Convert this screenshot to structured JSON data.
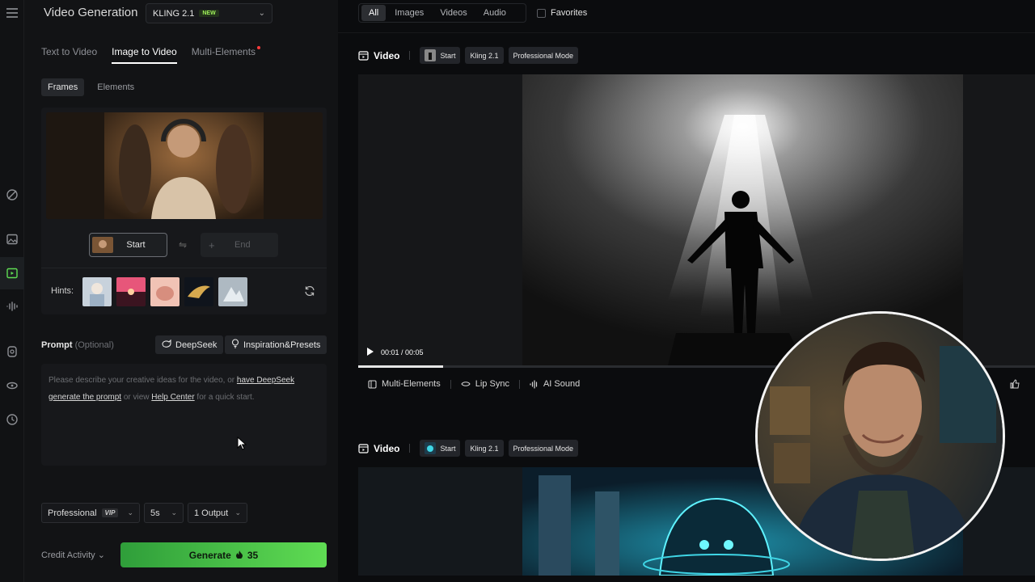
{
  "panel": {
    "title": "Video Generation",
    "model": {
      "name": "KLING 2.1",
      "badge": "NEW"
    },
    "tabs": [
      {
        "label": "Text to Video",
        "active": false
      },
      {
        "label": "Image to Video",
        "active": true
      },
      {
        "label": "Multi-Elements",
        "active": false,
        "notification_dot": true
      }
    ],
    "subtabs": [
      {
        "label": "Frames",
        "active": true
      },
      {
        "label": "Elements",
        "active": false
      }
    ],
    "frames": {
      "start_label": "Start",
      "end_label": "End",
      "hints_label": "Hints:"
    },
    "prompt": {
      "label": "Prompt",
      "optional": "(Optional)",
      "deepseek_button": "DeepSeek",
      "presets_button": "Inspiration&Presets",
      "placeholder_pre": "Please describe your creative ideas for the video, or ",
      "link_deepseek": "have DeepSeek generate the prompt",
      "placeholder_mid": " or view ",
      "link_help": "Help Center",
      "placeholder_post": " for a quick start."
    },
    "options": {
      "mode": "Professional",
      "mode_badge": "VIP",
      "duration": "5s",
      "outputs": "1 Output"
    },
    "credit_activity": "Credit Activity",
    "generate": {
      "label": "Generate",
      "cost": "35"
    }
  },
  "filters": {
    "items": [
      {
        "label": "All",
        "active": true
      },
      {
        "label": "Images",
        "active": false
      },
      {
        "label": "Videos",
        "active": false
      },
      {
        "label": "Audio",
        "active": false
      }
    ],
    "favorites": "Favorites"
  },
  "videos": [
    {
      "title": "Video",
      "tags": [
        "Start",
        "Kling 2.1",
        "Professional Mode"
      ],
      "time": "00:01 / 00:05",
      "progress": 0.125,
      "actions": [
        "Multi-Elements",
        "Lip Sync",
        "AI Sound"
      ]
    },
    {
      "title": "Video",
      "tags": [
        "Start",
        "Kling 2.1",
        "Professional Mode"
      ]
    }
  ],
  "colors": {
    "accent_green": "#5fdc53",
    "new_badge": "#9ff05a",
    "notification": "#ff3b3b"
  }
}
